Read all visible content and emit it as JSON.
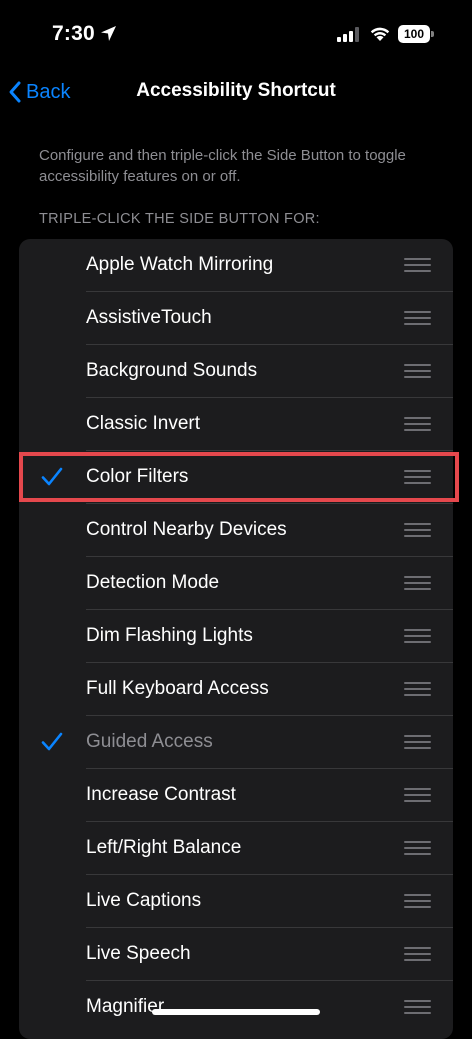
{
  "status_bar": {
    "time": "7:30",
    "battery": "100"
  },
  "nav": {
    "back_label": "Back",
    "title": "Accessibility Shortcut"
  },
  "description": "Configure and then triple-click the Side Button to toggle accessibility features on or off.",
  "section_header": "TRIPLE-CLICK THE SIDE BUTTON FOR:",
  "colors": {
    "accent": "#0a84ff",
    "highlight": "#e5484d",
    "card": "#1c1c1e",
    "secondary_text": "#8e8e93"
  },
  "items": [
    {
      "label": "Apple Watch Mirroring",
      "checked": false,
      "dimmed": false
    },
    {
      "label": "AssistiveTouch",
      "checked": false,
      "dimmed": false
    },
    {
      "label": "Background Sounds",
      "checked": false,
      "dimmed": false
    },
    {
      "label": "Classic Invert",
      "checked": false,
      "dimmed": false
    },
    {
      "label": "Color Filters",
      "checked": true,
      "dimmed": false,
      "highlighted": true
    },
    {
      "label": "Control Nearby Devices",
      "checked": false,
      "dimmed": false
    },
    {
      "label": "Detection Mode",
      "checked": false,
      "dimmed": false
    },
    {
      "label": "Dim Flashing Lights",
      "checked": false,
      "dimmed": false
    },
    {
      "label": "Full Keyboard Access",
      "checked": false,
      "dimmed": false
    },
    {
      "label": "Guided Access",
      "checked": true,
      "dimmed": true
    },
    {
      "label": "Increase Contrast",
      "checked": false,
      "dimmed": false
    },
    {
      "label": "Left/Right Balance",
      "checked": false,
      "dimmed": false
    },
    {
      "label": "Live Captions",
      "checked": false,
      "dimmed": false
    },
    {
      "label": "Live Speech",
      "checked": false,
      "dimmed": false
    },
    {
      "label": "Magnifier",
      "checked": false,
      "dimmed": false
    }
  ]
}
